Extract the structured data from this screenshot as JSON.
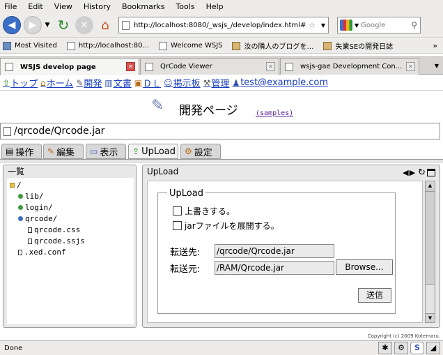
{
  "menubar": [
    "File",
    "Edit",
    "View",
    "History",
    "Bookmarks",
    "Tools",
    "Help"
  ],
  "navbar": {
    "url": "http://localhost:8080/_wsjs_/develop/index.html#",
    "search_placeholder": "Google"
  },
  "bookmarks": [
    "Most Visited",
    "http://localhost:80...",
    "Welcome WSJS",
    "汝の隣人のブログを…",
    "失業SEの開発日誌"
  ],
  "bookmarks_more": "»",
  "tabs": [
    "WSJS develop page",
    "QrCode Viewer",
    "wsjs-gae Development Con..."
  ],
  "sitenav": [
    "トップ",
    "ホーム",
    "開発",
    "文書",
    "ＤＬ",
    "掲示板",
    "管理",
    "test@example.com"
  ],
  "page": {
    "title": "開発ページ",
    "samples": "(samples)",
    "path": "/qrcode/Qrcode.jar"
  },
  "apptabs": [
    "操作",
    "編集",
    "表示",
    "UpLoad",
    "設定"
  ],
  "leftpanel": {
    "title": "一覧",
    "tree": [
      "/",
      "lib/",
      "login/",
      "qrcode/",
      "qrcode.css",
      "qrcode.ssjs",
      ".xed.conf"
    ]
  },
  "rightpanel": {
    "title": "UpLoad",
    "legend": "UpLoad",
    "overwrite_label": "上書きする。",
    "expand_label": "jarファイルを展開する。",
    "dest_label": "転送先:",
    "dest_value": "/qrcode/Qrcode.jar",
    "src_label": "転送元:",
    "src_value": "/RAM/Qrcode.jar",
    "browse_label": "Browse...",
    "submit_label": "送信"
  },
  "copyright": "Copyright (c) 2009 Kotemaru.",
  "status": "Done"
}
